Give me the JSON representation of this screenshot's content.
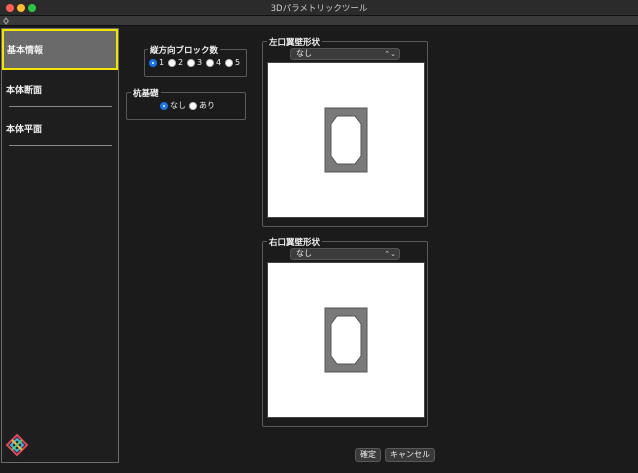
{
  "window": {
    "title": "3Dパラメトリックツール"
  },
  "sidebar": {
    "items": [
      {
        "label": "基本情報"
      },
      {
        "label": "本体断面"
      },
      {
        "label": "本体平面"
      }
    ]
  },
  "block_count": {
    "title": "縦方向ブロック数",
    "options": [
      "1",
      "2",
      "3",
      "4",
      "5"
    ],
    "selected": "1"
  },
  "pile_foundation": {
    "title": "杭基礎",
    "options": [
      "なし",
      "あり"
    ],
    "selected": "なし"
  },
  "left_wing": {
    "title": "左口翼壁形状",
    "select_value": "なし"
  },
  "right_wing": {
    "title": "右口翼壁形状",
    "select_value": "なし"
  },
  "buttons": {
    "confirm": "確定",
    "cancel": "キャンセル"
  },
  "icons": {
    "toolbar": "diamond-icon",
    "app": "app-logo-icon",
    "select_arrow": "updown-chevron-icon"
  }
}
